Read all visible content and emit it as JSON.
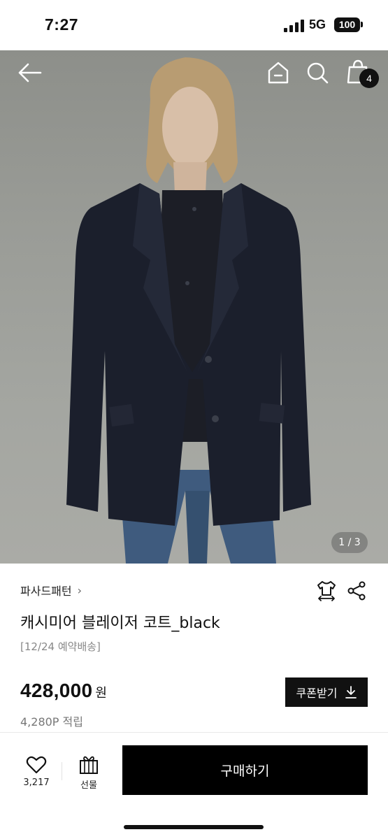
{
  "status_bar": {
    "time": "7:27",
    "network": "5G",
    "battery": "100"
  },
  "header": {
    "cart_count": "4",
    "icons": [
      "back-arrow-icon",
      "home-icon",
      "search-icon",
      "shopping-bag-icon"
    ]
  },
  "gallery": {
    "page_indicator": "1 / 3"
  },
  "product": {
    "brand": "파사드패턴",
    "name": "캐시미어 블레이저 코트_black",
    "shipping_note": "[12/24 예약배송]",
    "price": "428,000",
    "price_unit": "원",
    "points": "4,280P 적립",
    "coupon_label": "쿠폰받기"
  },
  "bottom_bar": {
    "like_count": "3,217",
    "gift_label": "선물",
    "buy_label": "구매하기"
  },
  "colors": {
    "accent": "#000000",
    "muted_text": "#888888"
  }
}
